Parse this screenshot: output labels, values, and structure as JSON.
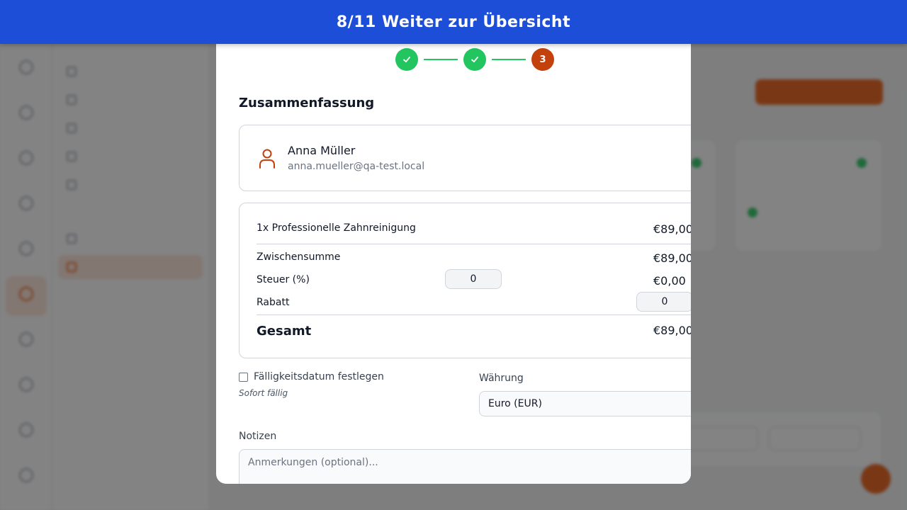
{
  "banner": {
    "text": "8/11 Weiter zur Übersicht"
  },
  "background": {
    "rail_items": [
      "",
      "",
      "",
      "",
      "",
      "",
      "",
      "",
      "",
      "",
      ""
    ],
    "side_items": [
      "",
      "",
      "",
      "",
      "",
      "",
      ""
    ],
    "create_button": "",
    "cards": [
      "",
      ""
    ],
    "filters": [
      "",
      ""
    ]
  },
  "wizard": {
    "steps": [
      {
        "state": "done",
        "label": "✓"
      },
      {
        "state": "done",
        "label": "✓"
      },
      {
        "state": "current",
        "label": "3"
      }
    ]
  },
  "summary": {
    "title": "Zusammenfassung",
    "customer": {
      "name": "Anna Müller",
      "email": "anna.mueller@qa-test.local",
      "icon": "user-icon"
    },
    "line_items": [
      {
        "label": "1x Professionelle Zahnreinigung",
        "amount": "€89,00"
      }
    ],
    "subtotal": {
      "label": "Zwischensumme",
      "amount": "€89,00"
    },
    "tax": {
      "label": "Steuer (%)",
      "value": "0",
      "amount": "€0,00"
    },
    "discount": {
      "label": "Rabatt",
      "value": "0"
    },
    "total": {
      "label": "Gesamt",
      "amount": "€89,00"
    }
  },
  "options": {
    "due_date_label": "Fälligkeitsdatum festlegen",
    "due_date_hint": "Sofort fällig",
    "currency_label": "Währung",
    "currency_value": "Euro (EUR)"
  },
  "notes": {
    "label": "Notizen",
    "placeholder": "Anmerkungen (optional)..."
  },
  "colors": {
    "banner": "#1d4ed8",
    "step_done": "#22c55e",
    "step_current": "#c2410c",
    "accent": "#ea580c"
  }
}
